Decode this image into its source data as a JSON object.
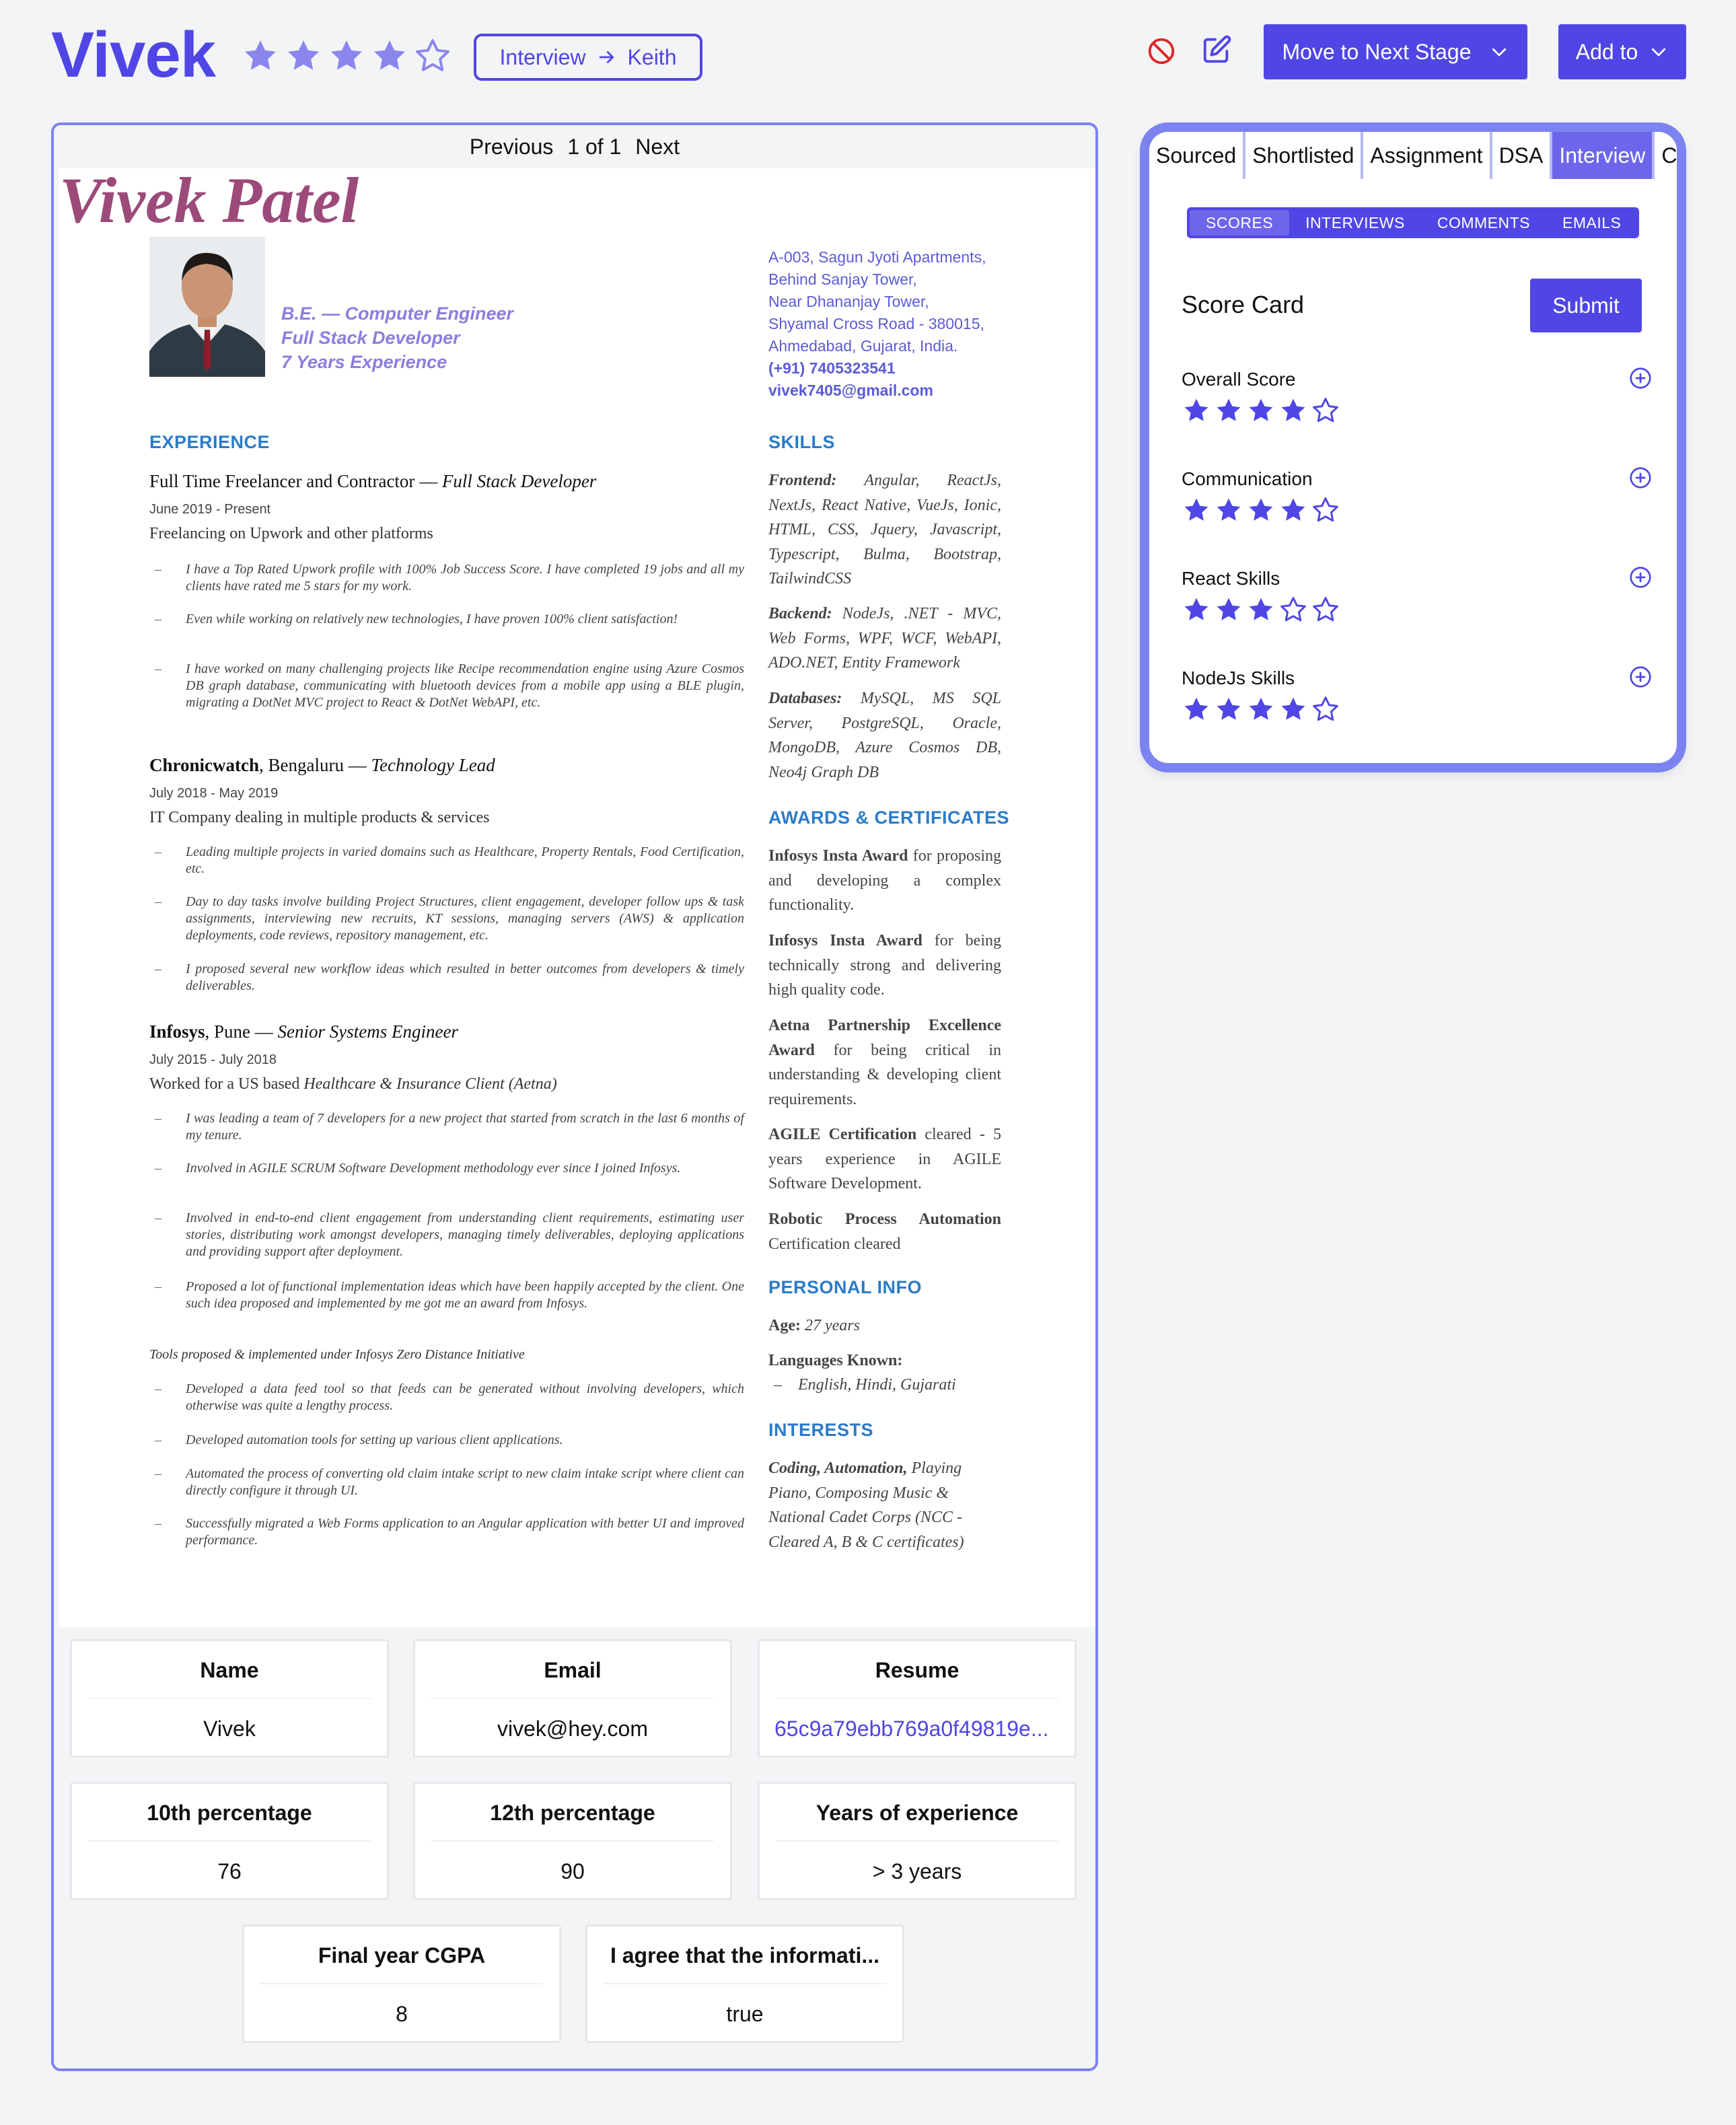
{
  "header": {
    "name": "Vivek",
    "rating": 4,
    "stage_from": "Interview",
    "stage_to": "Keith",
    "move_label": "Move to Next Stage",
    "add_label": "Add to"
  },
  "viewer": {
    "prev": "Previous",
    "page": "1 of 1",
    "next": "Next"
  },
  "resume": {
    "name": "Vivek Patel",
    "lines": [
      "B.E. — Computer Engineer",
      "Full Stack Developer",
      "7 Years Experience"
    ],
    "address": [
      "A-003, Sagun Jyoti Apartments,",
      "Behind Sanjay Tower,",
      "Near Dhananjay Tower,",
      "Shyamal Cross Road - 380015,",
      "Ahmedabad, Gujarat, India."
    ],
    "phone": "(+91) 7405323541",
    "email": "vivek7405@gmail.com",
    "experience_heading": "EXPERIENCE",
    "jobs": [
      {
        "company": "Full Time Freelancer and Contractor",
        "role": "Full Stack Developer",
        "dates": "June 2019 - Present",
        "summary": "Freelancing on Upwork and other platforms",
        "bullets": [
          "I have a Top Rated Upwork profile with 100% Job Success Score. I have completed 19 jobs and all my clients have rated me 5 stars for my work.",
          "Even while working on relatively new technologies, I have proven 100% client satisfaction!",
          "I have worked on many challenging projects like Recipe recommendation engine using Azure Cosmos DB graph database, communicating with bluetooth devices from a mobile app using a BLE plugin, migrating a DotNet MVC project to React & DotNet WebAPI, etc."
        ]
      },
      {
        "company": "Chronicwatch",
        "location": ", Bengaluru",
        "role": "Technology Lead",
        "dates": "July 2018 - May 2019",
        "summary": "IT Company dealing in multiple products & services",
        "bullets": [
          "Leading multiple projects in varied domains such as Healthcare, Property Rentals, Food Certification, etc.",
          "Day to day tasks involve building Project Structures, client engagement, developer follow ups & task assignments, interviewing new recruits, KT sessions, managing servers (AWS) & application deployments, code reviews, repository management, etc.",
          "I proposed several new workflow ideas which resulted in better outcomes from developers & timely deliverables."
        ]
      },
      {
        "company": "Infosys",
        "location": ", Pune",
        "role": "Senior Systems Engineer",
        "dates": "July 2015 - July 2018",
        "summary_pre": "Worked for a US based ",
        "summary_em": "Healthcare & Insurance Client (Aetna)",
        "bullets": [
          "I was leading a team of 7 developers for a new project that started from scratch in the last 6 months of my tenure.",
          "Involved in AGILE SCRUM Software Development methodology ever since I joined Infosys.",
          "Involved in end-to-end client engagement from understanding client requirements, estimating user stories, distributing work amongst developers, managing timely deliverables, deploying applications and providing support after deployment.",
          "Proposed a lot of functional implementation ideas which have been happily accepted by the client. One such idea proposed and implemented by me got me an award from Infosys."
        ],
        "tools_heading": "Tools proposed & implemented under Infosys Zero Distance Initiative",
        "tools": [
          "Developed a data feed tool so that feeds can be generated without involving developers, which otherwise was quite a lengthy process.",
          "Developed automation tools for setting up various client applications.",
          "Automated the process of converting old claim intake script to new claim intake script where client can directly configure it through UI.",
          "Successfully migrated a Web Forms application to an Angular application with better UI and improved performance."
        ]
      }
    ],
    "skills_heading": "SKILLS",
    "skills": [
      {
        "label": "Frontend:",
        "text": "Angular, ReactJs, NextJs, React Native, VueJs, Ionic, HTML, CSS, Jquery, Javascript, Typescript, Bulma, Bootstrap, TailwindCSS"
      },
      {
        "label": "Backend:",
        "text": "NodeJs, .NET - MVC, Web Forms, WPF, WCF, WebAPI, ADO.NET, Entity Framework"
      },
      {
        "label": "Databases:",
        "text": "MySQL, MS SQL Server, PostgreSQL, Oracle, MongoDB, Azure Cosmos DB, Neo4j Graph DB"
      }
    ],
    "awards_heading": "AWARDS & CERTIFICATES",
    "awards": [
      {
        "bold": "Infosys Insta Award",
        "text": " for proposing and developing a complex functionality."
      },
      {
        "bold": "Infosys Insta Award",
        "text": " for being technically strong and delivering high quality code."
      },
      {
        "bold": "Aetna Partnership Excellence Award",
        "text": " for being critical in understanding & developing client requirements."
      },
      {
        "bold": "AGILE Certification",
        "text": " cleared - 5 years experience in AGILE Software Development."
      },
      {
        "bold": "Robotic Process Automation",
        "text": " Certification cleared"
      }
    ],
    "personal_heading": "PERSONAL INFO",
    "age_label": "Age:",
    "age": " 27 years",
    "languages_label": "Languages Known:",
    "languages": "English, Hindi, Gujarati",
    "interests_heading": "INTERESTS",
    "interests_bold": "Coding, Automation,",
    "interests_text": " Playing Piano, Composing Music & National Cadet Corps (NCC - Cleared A, B & C certificates)"
  },
  "fields": [
    {
      "label": "Name",
      "value": "Vivek"
    },
    {
      "label": "Email",
      "value": "vivek@hey.com"
    },
    {
      "label": "Resume",
      "value": "65c9a79ebb769a0f49819e..."
    },
    {
      "label": "10th percentage",
      "value": "76"
    },
    {
      "label": "12th percentage",
      "value": "90"
    },
    {
      "label": "Years of experience",
      "value": "> 3 years"
    },
    {
      "label": "Final year CGPA",
      "value": "8"
    },
    {
      "label": "I agree that the informati...",
      "value": "true"
    }
  ],
  "stages": [
    "Sourced",
    "Shortlisted",
    "Assignment",
    "DSA",
    "Interview",
    "C"
  ],
  "active_stage": "Interview",
  "subtabs": [
    "SCORES",
    "INTERVIEWS",
    "COMMENTS",
    "EMAILS"
  ],
  "scorecard": {
    "title": "Score Card",
    "submit": "Submit",
    "items": [
      {
        "label": "Overall Score",
        "rating": 4
      },
      {
        "label": "Communication",
        "rating": 4
      },
      {
        "label": "React Skills",
        "rating": 3
      },
      {
        "label": "NodeJs Skills",
        "rating": 4
      }
    ]
  },
  "colors": {
    "accent": "#4f46e5",
    "stage_active": "#6d66ea",
    "resume_name": "#9c4a7a",
    "section_heading": "#2b7bc9"
  }
}
